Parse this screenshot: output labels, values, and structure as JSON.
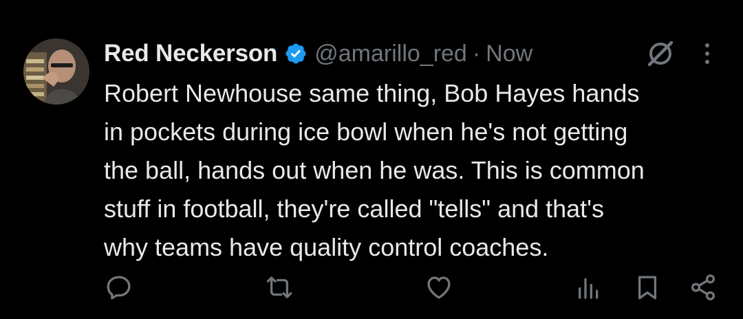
{
  "tweet": {
    "author": {
      "display_name": "Red Neckerson",
      "handle": "@amarillo_red",
      "verified": true,
      "avatar_icon": "avatar-photo"
    },
    "separator": "·",
    "timestamp": "Now",
    "text": "Robert Newhouse same thing, Bob Hayes hands\nin pockets during ice bowl when he's not getting\nthe ball, hands out when he was. This is common\nstuff in football, they're called \"tells\" and that's\nwhy teams have quality control coaches."
  },
  "icons": {
    "verified": "verified-badge-icon",
    "grok": "grok-icon",
    "more": "more-options-icon",
    "reply": "reply-icon",
    "repost": "repost-icon",
    "like": "like-icon",
    "views": "views-icon",
    "bookmark": "bookmark-icon",
    "share": "share-icon"
  },
  "colors": {
    "background": "#000000",
    "primary_text": "#e7e9ea",
    "secondary_text": "#71767b",
    "verified_blue": "#1d9bf0"
  }
}
